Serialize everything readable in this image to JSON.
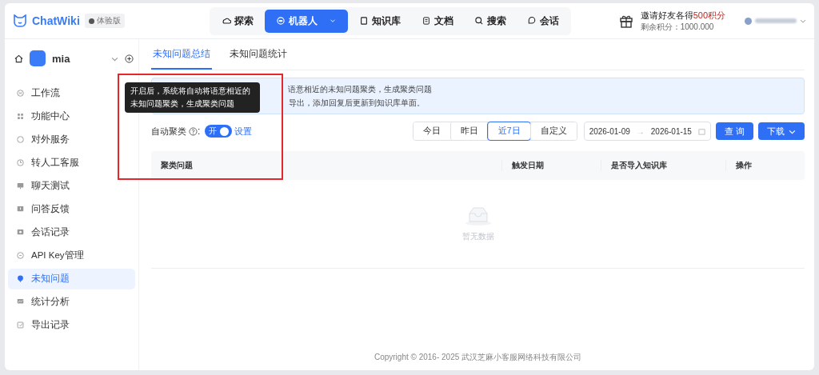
{
  "brand": {
    "name": "ChatWiki",
    "edition": "体验版"
  },
  "nav": [
    {
      "label": "探索",
      "selected": false
    },
    {
      "label": "机器人",
      "selected": true
    },
    {
      "label": "知识库",
      "selected": false
    },
    {
      "label": "文档",
      "selected": false
    },
    {
      "label": "搜索",
      "selected": false
    },
    {
      "label": "会话",
      "selected": false
    }
  ],
  "invite": {
    "text": "邀请好友各得",
    "highlight": "500积分",
    "points": "剩余积分：1000.000"
  },
  "robot": {
    "name": "mia"
  },
  "sidebar": {
    "items": [
      {
        "label": "工作流",
        "selected": false
      },
      {
        "label": "功能中心",
        "selected": false
      },
      {
        "label": "对外服务",
        "selected": false
      },
      {
        "label": "转人工客服",
        "selected": false
      },
      {
        "label": "聊天测试",
        "selected": false
      },
      {
        "label": "问答反馈",
        "selected": false
      },
      {
        "label": "会话记录",
        "selected": false
      },
      {
        "label": "API Key管理",
        "selected": false
      },
      {
        "label": "未知问题",
        "selected": true
      },
      {
        "label": "统计分析",
        "selected": false
      },
      {
        "label": "导出记录",
        "selected": false
      }
    ]
  },
  "tabs": [
    {
      "label": "未知问题总结",
      "selected": true
    },
    {
      "label": "未知问题统计",
      "selected": false
    }
  ],
  "info": {
    "line_1": "语意相近的未知问题聚类，生成聚类问题",
    "line_2": "导出，添加回复后更新到知识库单面。"
  },
  "auto_cluster": {
    "label": "自动聚类",
    "colon": ":",
    "on": true,
    "switch_text": "开",
    "settings": "设置"
  },
  "tooltip": "开启后，系统将自动将语意相近的未知问题聚类，生成聚类问题",
  "ranges": [
    {
      "label": "今日",
      "selected": false
    },
    {
      "label": "昨日",
      "selected": false
    },
    {
      "label": "近7日",
      "selected": true
    },
    {
      "label": "自定义",
      "selected": false
    }
  ],
  "date_range": {
    "start": "2026-01-09",
    "end": "2026-01-15",
    "separator": "→"
  },
  "buttons": {
    "query": "查 询",
    "download": "下载"
  },
  "table": {
    "columns": [
      "聚类问题",
      "触发日期",
      "是否导入知识库",
      "操作"
    ],
    "empty": "暂无数据"
  },
  "footer": "Copyright © 2016- 2025 武汉芝麻小客服网络科技有限公司"
}
